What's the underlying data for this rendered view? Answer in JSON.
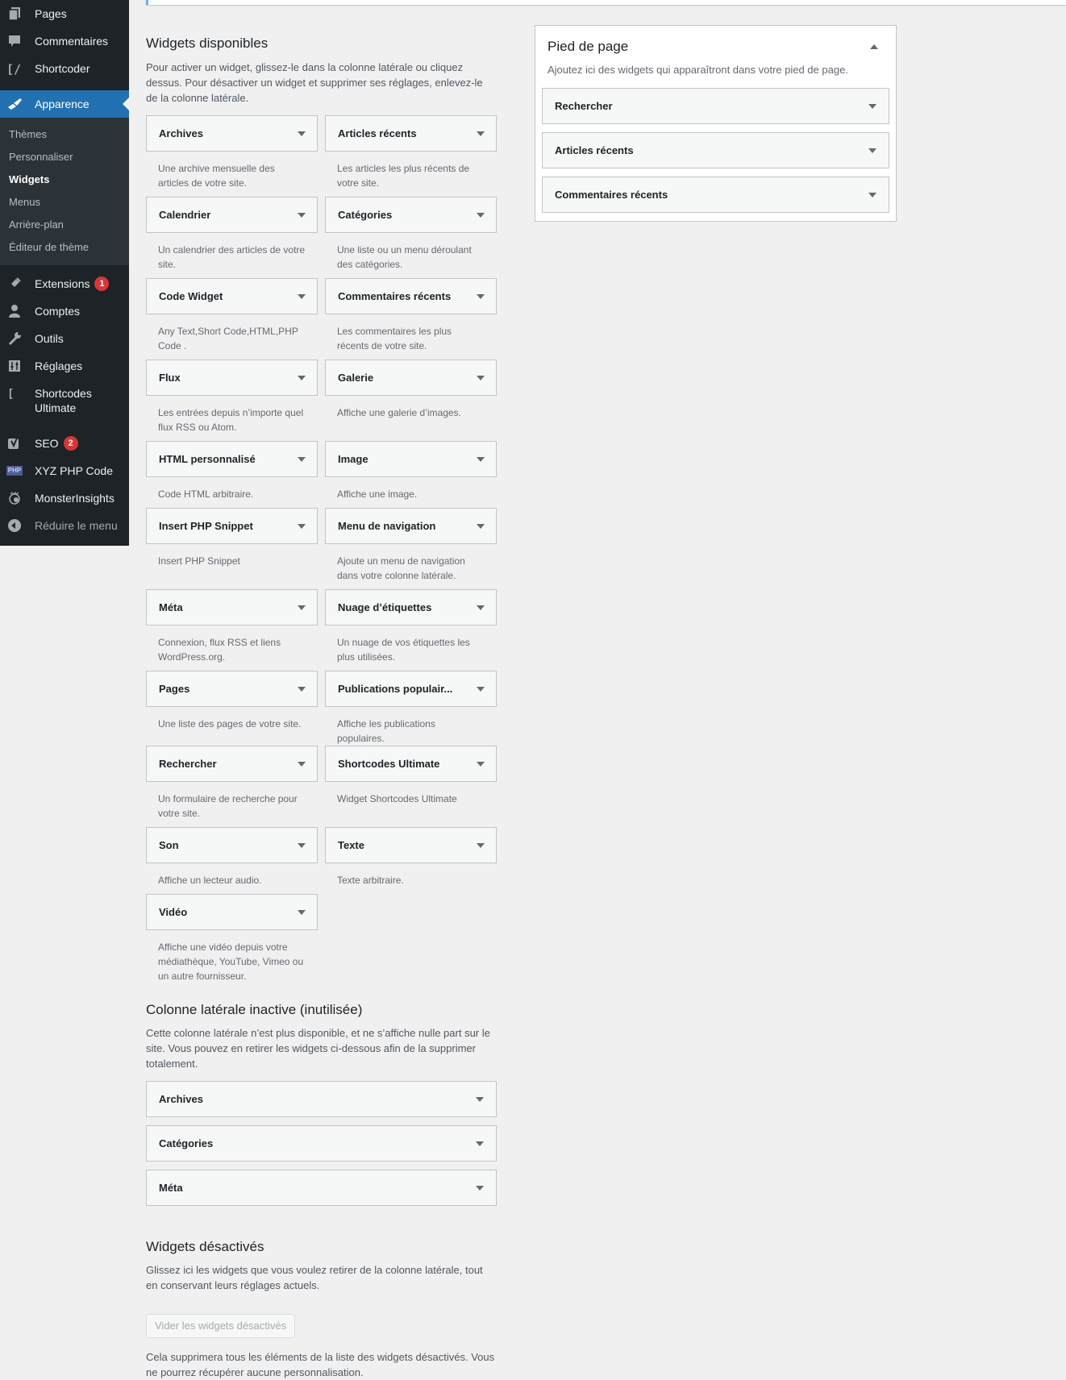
{
  "sidebar": {
    "top_items": [
      {
        "label": "Pages",
        "icon": "pages-icon"
      },
      {
        "label": "Commentaires",
        "icon": "comments-icon"
      },
      {
        "label": "Shortcoder",
        "icon": "shortcoder-icon"
      }
    ],
    "current": {
      "label": "Apparence",
      "icon": "paintbrush-icon"
    },
    "submenu": [
      {
        "label": "Thèmes",
        "current": false
      },
      {
        "label": "Personnaliser",
        "current": false
      },
      {
        "label": "Widgets",
        "current": true
      },
      {
        "label": "Menus",
        "current": false
      },
      {
        "label": "Arrière-plan",
        "current": false
      },
      {
        "label": "Éditeur de thème",
        "current": false
      }
    ],
    "bottom_items": [
      {
        "label": "Extensions",
        "icon": "plugins-icon",
        "badge": "1"
      },
      {
        "label": "Comptes",
        "icon": "users-icon"
      },
      {
        "label": "Outils",
        "icon": "tools-icon"
      },
      {
        "label": "Réglages",
        "icon": "settings-icon"
      },
      {
        "label": "Shortcodes Ultimate",
        "icon": "shortcodes-ultimate-icon"
      },
      {
        "label": "SEO",
        "icon": "yoast-seo-icon",
        "badge": "2"
      },
      {
        "label": "XYZ PHP Code",
        "icon": "php-icon",
        "icon_text": "PHP"
      },
      {
        "label": "MonsterInsights",
        "icon": "monsterinsights-icon"
      }
    ],
    "collapse_label": "Réduire le menu"
  },
  "available": {
    "title": "Widgets disponibles",
    "description": "Pour activer un widget, glissez-le dans la colonne latérale ou cliquez dessus. Pour désactiver un widget et supprimer ses réglages, enlevez-le de la colonne latérale.",
    "widgets": [
      {
        "title": "Archives",
        "desc": "Une archive mensuelle des articles de votre site."
      },
      {
        "title": "Articles récents",
        "desc": "Les articles les plus récents de votre site."
      },
      {
        "title": "Calendrier",
        "desc": "Un calendrier des articles de votre site."
      },
      {
        "title": "Catégories",
        "desc": "Une liste ou un menu déroulant des catégories."
      },
      {
        "title": "Code Widget",
        "desc": "Any Text,Short Code,HTML,PHP Code ."
      },
      {
        "title": "Commentaires récents",
        "desc": "Les commentaires les plus récents de votre site."
      },
      {
        "title": "Flux",
        "desc": "Les entrées depuis n’importe quel flux RSS ou Atom."
      },
      {
        "title": "Galerie",
        "desc": "Affiche une galerie d’images."
      },
      {
        "title": "HTML personnalisé",
        "desc": "Code HTML arbitraire."
      },
      {
        "title": "Image",
        "desc": "Affiche une image."
      },
      {
        "title": "Insert PHP Snippet",
        "desc": "Insert PHP Snippet"
      },
      {
        "title": "Menu de navigation",
        "desc": "Ajoute un menu de navigation dans votre colonne latérale."
      },
      {
        "title": "Méta",
        "desc": "Connexion, flux RSS et liens WordPress.org."
      },
      {
        "title": "Nuage d’étiquettes",
        "desc": "Un nuage de vos étiquettes les plus utilisées."
      },
      {
        "title": "Pages",
        "desc": "Une liste des pages de votre site."
      },
      {
        "title": "Publications populair...",
        "desc": "Affiche les publications populaires."
      },
      {
        "title": "Rechercher",
        "desc": "Un formulaire de recherche pour votre site."
      },
      {
        "title": "Shortcodes Ultimate",
        "desc": "Widget Shortcodes Ultimate"
      },
      {
        "title": "Son",
        "desc": "Affiche un lecteur audio."
      },
      {
        "title": "Texte",
        "desc": "Texte arbitraire."
      },
      {
        "title": "Vidéo",
        "desc": "Affiche une vidéo depuis votre médiathèque, YouTube, Vimeo ou un autre fournisseur."
      }
    ]
  },
  "inactive_sidebar": {
    "title": "Colonne latérale inactive (inutilisée)",
    "description": "Cette colonne latérale n’est plus disponible, et ne s’affiche nulle part sur le site. Vous pouvez en retirer les widgets ci-dessous afin de la supprimer totalement.",
    "widgets": [
      "Archives",
      "Catégories",
      "Méta"
    ]
  },
  "disabled": {
    "title": "Widgets désactivés",
    "description": "Glissez ici les widgets que vous voulez retirer de la colonne latérale, tout en conservant leurs réglages actuels.",
    "button_label": "Vider les widgets désactivés",
    "note": "Cela supprimera tous les éléments de la liste des widgets désactivés. Vous ne pourrez récupérer aucune personnalisation."
  },
  "footer_sidebar": {
    "title": "Pied de page",
    "description": "Ajoutez ici des widgets qui apparaîtront dans votre pied de page.",
    "widgets": [
      "Rechercher",
      "Articles récents",
      "Commentaires récents"
    ]
  }
}
